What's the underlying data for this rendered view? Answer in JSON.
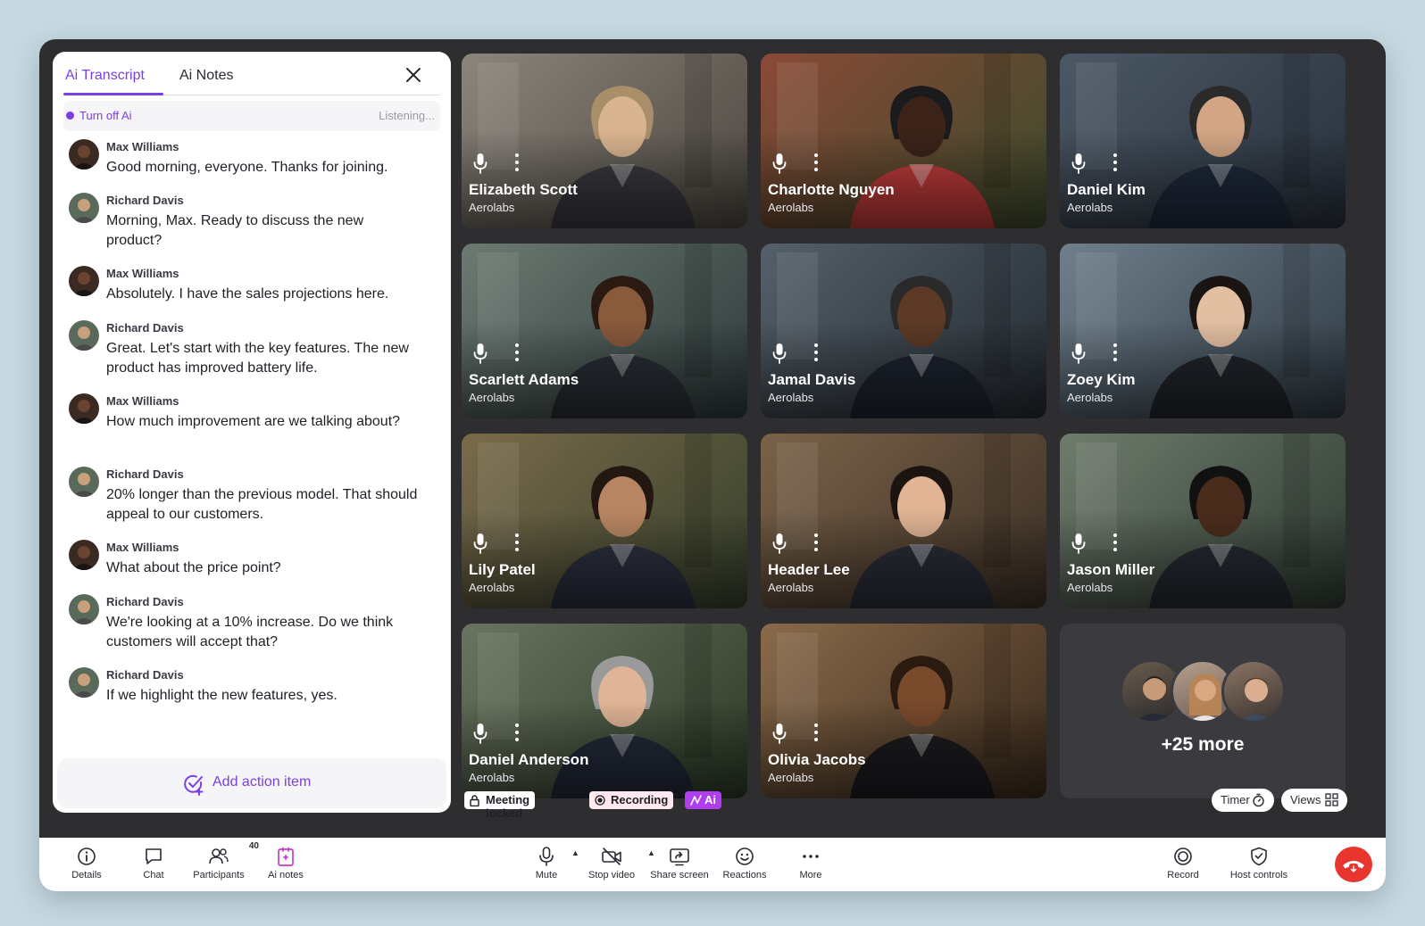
{
  "panel": {
    "tabs": [
      {
        "label": "Ai Transcript"
      },
      {
        "label": "Ai Notes"
      }
    ],
    "status": {
      "toggle_label": "Turn off Ai",
      "state": "Listening..."
    },
    "messages": [
      {
        "name": "Max Williams",
        "text": "Good morning, everyone. Thanks for joining."
      },
      {
        "name": "Richard Davis",
        "text": "Morning, Max. Ready to discuss the new product?"
      },
      {
        "name": "Max Williams",
        "text": "Absolutely. I have the sales projections here."
      },
      {
        "name": "Richard Davis",
        "text": "Great. Let's start with the key features. The new product has improved battery life."
      },
      {
        "name": "Max Williams",
        "text": "How much improvement are we talking about?"
      },
      {
        "name": "Richard Davis",
        "text": "20% longer than the previous model. That should appeal to our customers."
      },
      {
        "name": "Max Williams",
        "text": "What about the price point?"
      },
      {
        "name": "Richard Davis",
        "text": "We're looking at a 10% increase. Do we think customers will accept that?"
      },
      {
        "name": "Richard Davis",
        "text": "If we highlight the new features, yes."
      }
    ],
    "add_action_label": "Add action item"
  },
  "participants": [
    {
      "name": "Elizabeth Scott",
      "org": "Aerolabs"
    },
    {
      "name": "Charlotte Nguyen",
      "org": "Aerolabs"
    },
    {
      "name": "Daniel Kim",
      "org": "Aerolabs"
    },
    {
      "name": "Scarlett Adams",
      "org": "Aerolabs"
    },
    {
      "name": "Jamal Davis",
      "org": "Aerolabs"
    },
    {
      "name": "Zoey Kim",
      "org": "Aerolabs"
    },
    {
      "name": "Lily Patel",
      "org": "Aerolabs"
    },
    {
      "name": "Header Lee",
      "org": "Aerolabs"
    },
    {
      "name": "Jason Miller",
      "org": "Aerolabs"
    },
    {
      "name": "Daniel Anderson",
      "org": "Aerolabs"
    },
    {
      "name": "Olivia Jacobs",
      "org": "Aerolabs"
    }
  ],
  "more_label": "+25 more",
  "badges": {
    "locked": "Meeting locked",
    "recording": "Recording",
    "ai": "Ai"
  },
  "pills": {
    "timer": "Timer",
    "views": "Views"
  },
  "toolbar": {
    "details": "Details",
    "chat": "Chat",
    "participants": "Participants",
    "participants_count": "40",
    "ai_notes": "Ai notes",
    "mute": "Mute",
    "stop_video": "Stop video",
    "share_screen": "Share screen",
    "reactions": "Reactions",
    "more": "More",
    "record": "Record",
    "host_controls": "Host controls"
  },
  "colors": {
    "accent": "#7b3fe4",
    "ai_badge": "#b03ef0",
    "end_call": "#e8352e",
    "window_bg": "#2e2e31"
  }
}
